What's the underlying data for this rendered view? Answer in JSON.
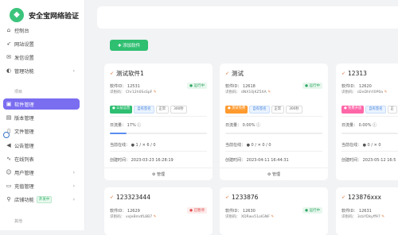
{
  "brand": {
    "logo_glyph": "◆",
    "name": "安全宝网络验证"
  },
  "sidebar": {
    "items": [
      {
        "label": "控制台",
        "icon": "dashboard-icon",
        "glyph": "⌂"
      },
      {
        "label": "网站设置",
        "icon": "rocket-icon",
        "glyph": "➶"
      },
      {
        "label": "发信设置",
        "icon": "mail-icon",
        "glyph": "✉"
      },
      {
        "label": "管理功能",
        "icon": "speaker-icon",
        "glyph": "◐",
        "chevron": "›"
      }
    ],
    "section_label": "项目",
    "project_items": [
      {
        "label": "软件管理",
        "icon": "app-icon",
        "glyph": "▣",
        "active": true
      },
      {
        "label": "版本管理",
        "icon": "book-icon",
        "glyph": "▤"
      },
      {
        "label": "文件管理",
        "icon": "file-icon",
        "glyph": "▯"
      },
      {
        "label": "公告管理",
        "icon": "megaphone-icon",
        "glyph": "◀"
      },
      {
        "label": "在线列表",
        "icon": "pulse-icon",
        "glyph": "∿"
      },
      {
        "label": "用户管理",
        "icon": "users-icon",
        "glyph": "☺",
        "chevron": "›"
      },
      {
        "label": "充值管理",
        "icon": "card-icon",
        "glyph": "▭",
        "chevron": "›"
      },
      {
        "label": "店铺功能",
        "icon": "shop-icon",
        "glyph": "⚲",
        "badge": "开发中",
        "chevron": "›"
      }
    ],
    "bottom_section_label": "其他"
  },
  "toolbar": {
    "add_label": "✚ 添加软件"
  },
  "cards": [
    {
      "title": "测试软件1",
      "software_id": "软件ID： 12531",
      "key_line": "识别码： Chr12h0SsSpF",
      "status": "● 运行中",
      "status_type": "green",
      "tags": [
        {
          "text": "● 公益运营",
          "kind": "green"
        },
        {
          "text": "自有签名",
          "kind": "blue"
        },
        {
          "text": "正常",
          "kind": "plain"
        },
        {
          "text": "300秒",
          "kind": "plain"
        }
      ],
      "traffic": "日流量： 17% ⓘ",
      "progress": 0.17,
      "online": "当前在线： ● 1 / ✕ 6 / 0",
      "created": "创建时间： 2023-03-23 16:28:19",
      "footer": "⚙ 管理"
    },
    {
      "title": "测试",
      "software_id": "软件ID： 12618",
      "key_line": "识别码： dNX10jKZ5XA",
      "status": "● 运行中",
      "status_type": "green",
      "tags": [
        {
          "text": "● 测试免费",
          "kind": "orange"
        },
        {
          "text": "自有签名",
          "kind": "blue"
        },
        {
          "text": "正常",
          "kind": "plain"
        },
        {
          "text": "300秒",
          "kind": "plain"
        }
      ],
      "traffic": "日流量： 0.00% ⓘ",
      "progress": 0.0,
      "online": "当前在线： ● 0 / ✕ 0 / 0",
      "created": "创建时间： 2023-04-11 16:44:31",
      "footer": "⚙ 管理"
    },
    {
      "title": "12313",
      "software_id": "软件ID： 12620",
      "key_line": "识别码： d2eDhhY0P0a",
      "status": "",
      "status_type": "green",
      "tags": [
        {
          "text": "● 免费开放",
          "kind": "pink"
        },
        {
          "text": "自有签名",
          "kind": "blue"
        },
        {
          "text": "正",
          "kind": "plain"
        }
      ],
      "traffic": "日流量： 0.00% ⓘ",
      "progress": 0.0,
      "online": "当前在线： ● 0 / ✕ 0",
      "created": "创建时间： 2023-05-12 16:5",
      "footer": ""
    },
    {
      "title": "123323444",
      "software_id": "软件ID： 12629",
      "key_line": "识别码： vxJeBmdfL8B7",
      "status": "● 已暂停",
      "status_type": "red"
    },
    {
      "title": "1233876",
      "software_id": "软件ID： 12630",
      "key_line": "识别码： XDRwv51oIGNF",
      "status": "● 运行中",
      "status_type": "green"
    },
    {
      "title": "123876xxx",
      "software_id": "软件ID： 12631",
      "key_line": "识别码： 3cbYDkyff97",
      "status": "",
      "status_type": "green"
    }
  ]
}
